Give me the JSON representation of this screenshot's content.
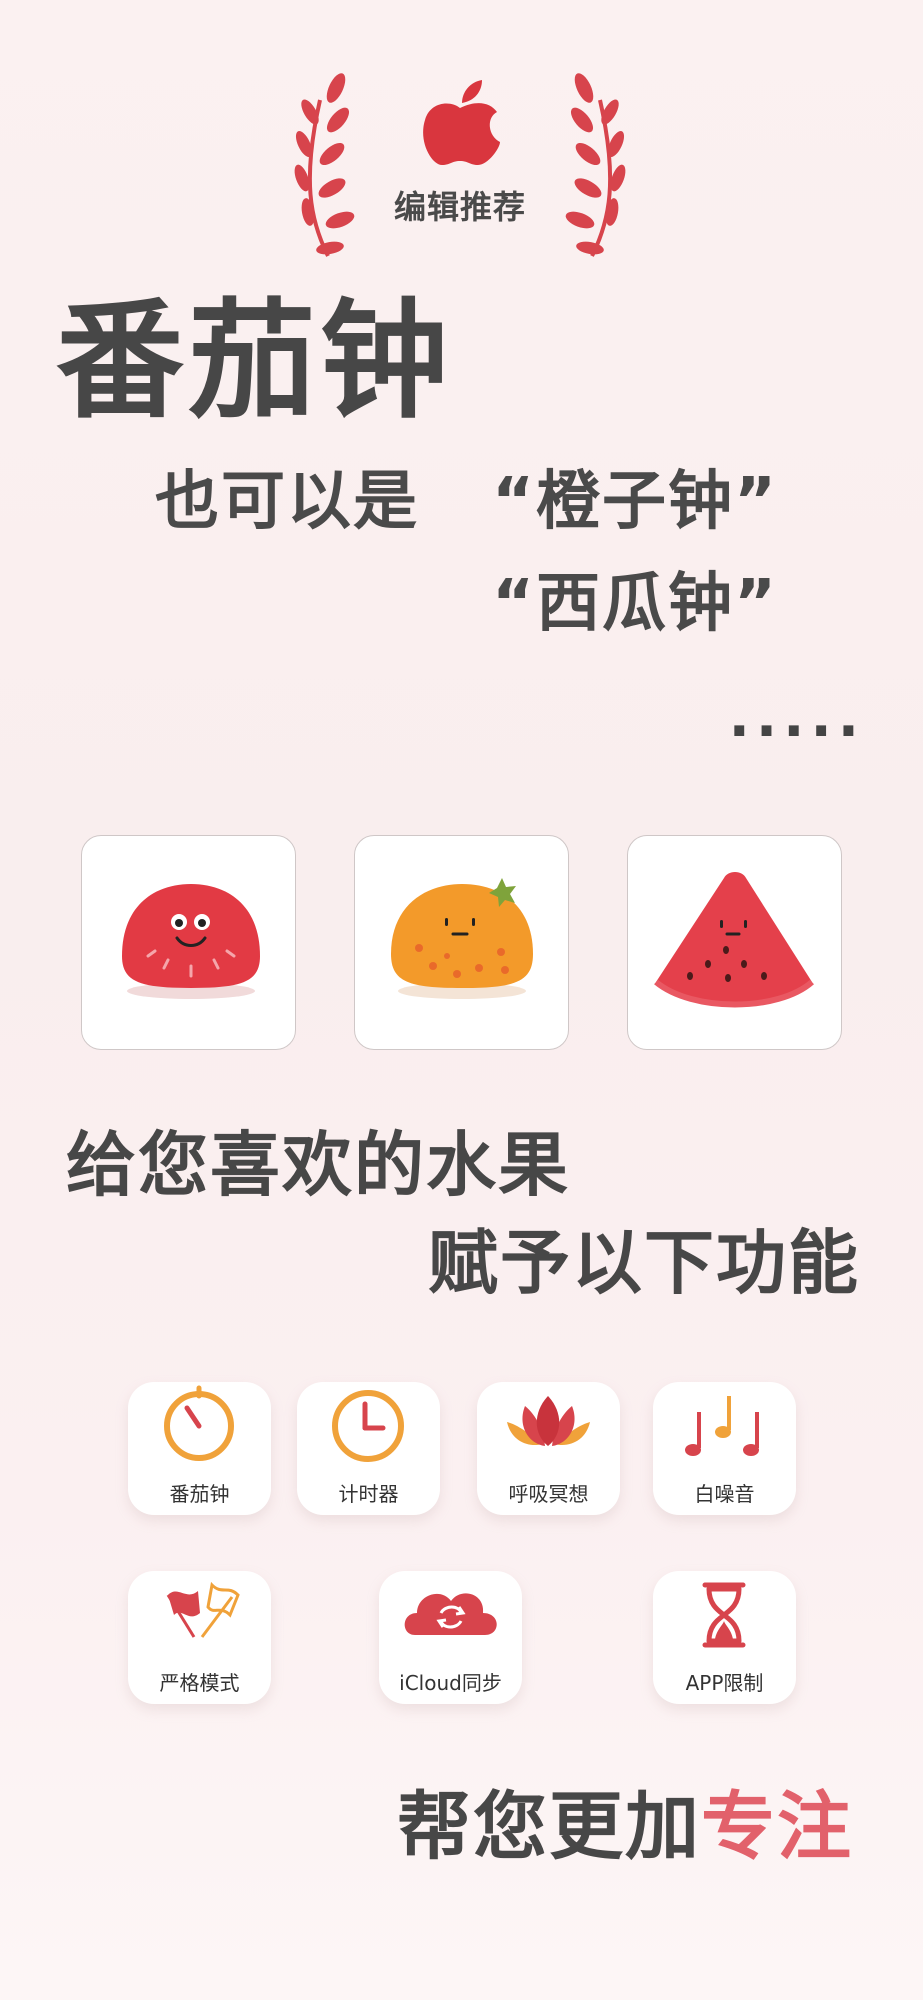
{
  "award": {
    "label": "编辑推荐",
    "icon": "apple-logo-icon",
    "color": "#d9363e"
  },
  "hero": {
    "title": "番茄钟",
    "sub_prefix": "也可以是",
    "alt1": "“橙子钟”",
    "alt2": "“西瓜钟”",
    "ellipsis": "....."
  },
  "fruits": [
    {
      "name": "tomato",
      "icon": "tomato-character-icon",
      "color": "#e23a44"
    },
    {
      "name": "orange",
      "icon": "orange-character-icon",
      "color": "#f39a2a"
    },
    {
      "name": "watermelon",
      "icon": "watermelon-character-icon",
      "color": "#e4404b"
    }
  ],
  "intro": {
    "line1": "给您喜欢的水果",
    "line2": "赋予以下功能"
  },
  "features": [
    {
      "label": "番茄钟",
      "icon": "stopwatch-icon"
    },
    {
      "label": "计时器",
      "icon": "clock-icon"
    },
    {
      "label": "呼吸冥想",
      "icon": "lotus-icon"
    },
    {
      "label": "白噪音",
      "icon": "music-notes-icon"
    },
    {
      "label": "严格模式",
      "icon": "flags-icon"
    },
    {
      "label": "iCloud同步",
      "icon": "cloud-sync-icon"
    },
    {
      "label": "APP限制",
      "icon": "hourglass-icon"
    }
  ],
  "tagline": {
    "prefix": "帮您更加",
    "accent": "专注",
    "accent_color": "#e2616b"
  }
}
